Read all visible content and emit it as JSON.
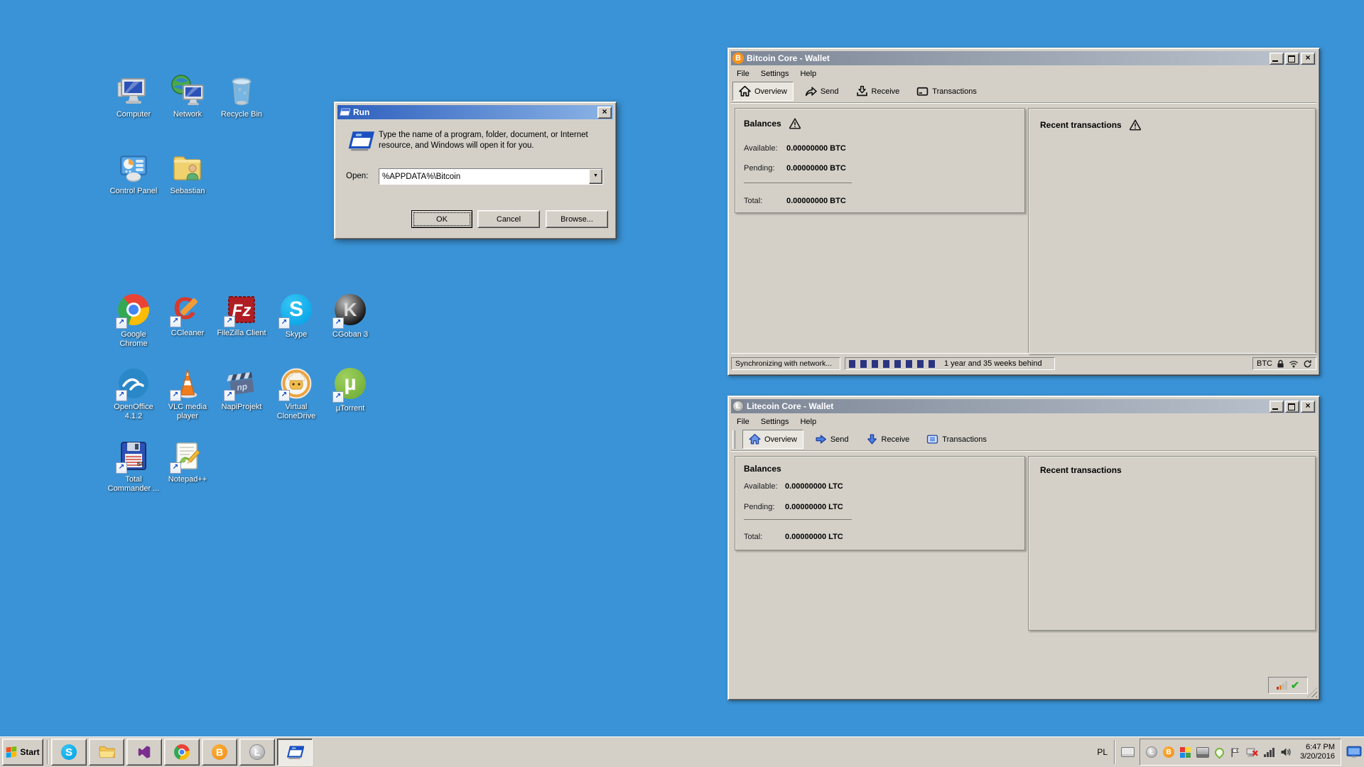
{
  "colors": {
    "desktop_blue": "#3a93d6",
    "active_title_start": "#2d5fbe",
    "active_title_end": "#8cb4e6",
    "inactive_title_start": "#7d8696",
    "inactive_title_end": "#bcc4ce",
    "bitcoin_orange": "#f7931a",
    "litecoin_silver": "#b8b8b8",
    "progress_blue": "#2b3480",
    "button_face": "#d4d0c8"
  },
  "desktop": {
    "icons": [
      {
        "label": "Computer"
      },
      {
        "label": "Network"
      },
      {
        "label": "Recycle Bin"
      },
      {
        "label": "Control Panel"
      },
      {
        "label": "Sebastian"
      },
      {
        "label": "Google Chrome"
      },
      {
        "label": "CCleaner"
      },
      {
        "label": "FileZilla Client"
      },
      {
        "label": "Skype"
      },
      {
        "label": "CGoban 3"
      },
      {
        "label": "OpenOffice 4.1.2"
      },
      {
        "label": "VLC media player"
      },
      {
        "label": "NapiProjekt"
      },
      {
        "label": "Virtual CloneDrive"
      },
      {
        "label": "µTorrent"
      },
      {
        "label": "Total Commander ..."
      },
      {
        "label": "Notepad++"
      }
    ]
  },
  "run_dialog": {
    "title": "Run",
    "message": "Type the name of a program, folder, document, or Internet resource, and Windows will open it for you.",
    "open_label": "Open:",
    "open_value": "%APPDATA%\\Bitcoin",
    "ok": "OK",
    "cancel": "Cancel",
    "browse": "Browse..."
  },
  "bitcoin": {
    "title": "Bitcoin Core - Wallet",
    "menu": [
      "File",
      "Settings",
      "Help"
    ],
    "tabs": [
      "Overview",
      "Send",
      "Receive",
      "Transactions"
    ],
    "balances_header": "Balances",
    "available_label": "Available:",
    "available_value": "0.00000000 BTC",
    "pending_label": "Pending:",
    "pending_value": "0.00000000 BTC",
    "total_label": "Total:",
    "total_value": "0.00000000 BTC",
    "recent_header": "Recent transactions",
    "sync_text": "Synchronizing with network...",
    "behind_text": "1 year and 35 weeks behind",
    "unit": "BTC"
  },
  "litecoin": {
    "title": "Litecoin Core - Wallet",
    "menu": [
      "File",
      "Settings",
      "Help"
    ],
    "tabs": [
      "Overview",
      "Send",
      "Receive",
      "Transactions"
    ],
    "balances_header": "Balances",
    "available_label": "Available:",
    "available_value": "0.00000000 LTC",
    "pending_label": "Pending:",
    "pending_value": "0.00000000 LTC",
    "total_label": "Total:",
    "total_value": "0.00000000 LTC",
    "recent_header": "Recent transactions"
  },
  "taskbar": {
    "start_label": "Start",
    "language": "PL",
    "time": "6:47 PM",
    "date": "3/20/2016"
  }
}
